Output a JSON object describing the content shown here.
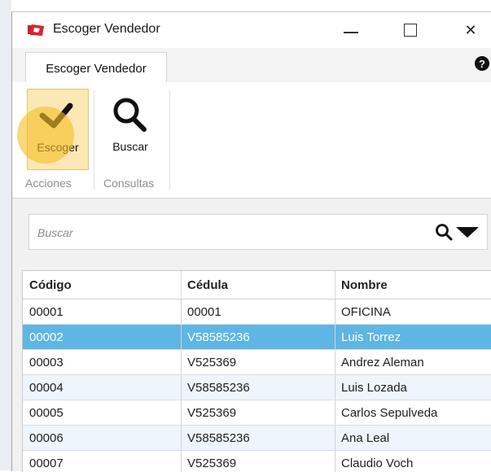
{
  "window": {
    "title": "Escoger Vendedor"
  },
  "ribbon": {
    "tab_label": "Escoger Vendedor",
    "escoger_label": "Escoger",
    "buscar_label": "Buscar",
    "group_acciones": "Acciones",
    "group_consultas": "Consultas"
  },
  "search": {
    "placeholder": "Buscar",
    "value": ""
  },
  "grid": {
    "columns": [
      "Código",
      "Cédula",
      "Nombre"
    ],
    "rows": [
      {
        "codigo": "00001",
        "cedula": "00001",
        "nombre": "OFICINA"
      },
      {
        "codigo": "00002",
        "cedula": "V58585236",
        "nombre": "Luis Torrez"
      },
      {
        "codigo": "00003",
        "cedula": "V525369",
        "nombre": "Andrez Aleman"
      },
      {
        "codigo": "00004",
        "cedula": "V58585236",
        "nombre": "Luis Lozada"
      },
      {
        "codigo": "00005",
        "cedula": "V525369",
        "nombre": "Carlos Sepulveda"
      },
      {
        "codigo": "00006",
        "cedula": "V58585236",
        "nombre": "Ana Leal"
      },
      {
        "codigo": "00007",
        "cedula": "V525369",
        "nombre": "Claudio Voch"
      }
    ],
    "selected_index": 1
  },
  "colors": {
    "selected_row": "#5eb6e4",
    "alt_row": "#eef5fc",
    "escoger_button": "#fbe8b4"
  },
  "icons": {
    "app": "app-logo-icon",
    "escoger": "checkmark-pencil-icon",
    "buscar": "search-icon",
    "help": "help-icon",
    "dropdown": "dropdown-triangle-icon"
  }
}
